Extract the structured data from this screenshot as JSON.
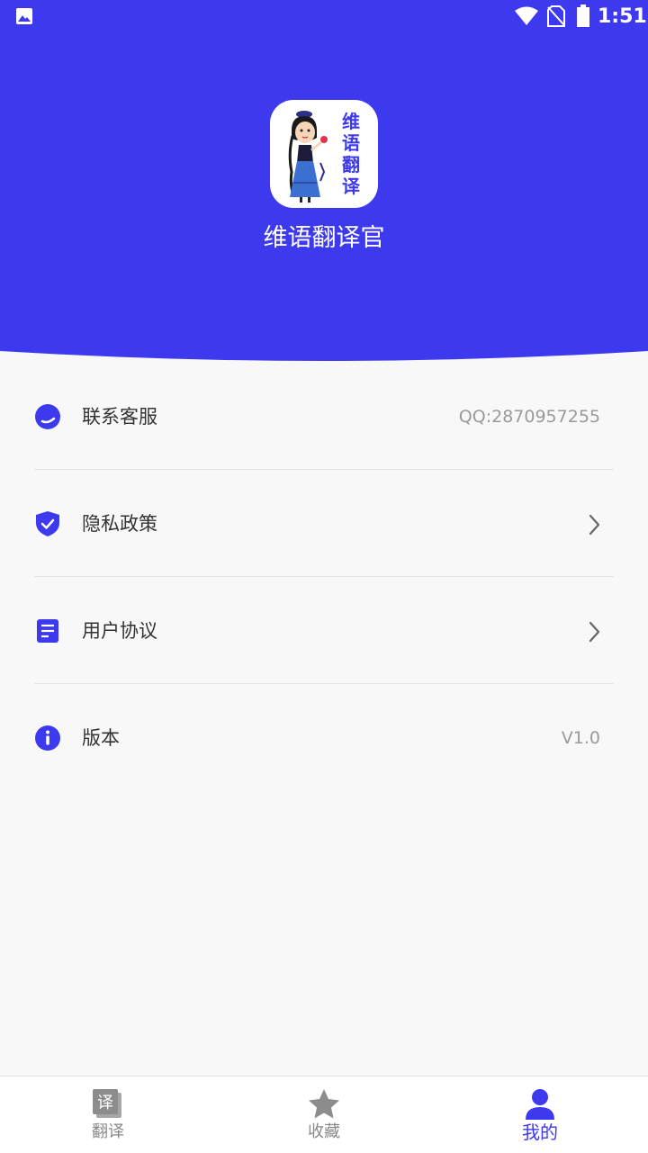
{
  "colors": {
    "brand": "#3d39ef",
    "background": "#f8f8f8",
    "text_primary": "#333333",
    "text_secondary": "#9a9a9a"
  },
  "status_bar": {
    "time": "1:51",
    "icons": [
      "photo-icon",
      "wifi-icon",
      "no-sim-icon",
      "battery-icon"
    ]
  },
  "header": {
    "logo_text": [
      "维",
      "语",
      "翻",
      "译"
    ],
    "app_name": "维语翻译官"
  },
  "menu": {
    "items": [
      {
        "icon": "customer-service-icon",
        "label": "联系客服",
        "value": "QQ:2870957255"
      },
      {
        "icon": "shield-check-icon",
        "label": "隐私政策",
        "chevron": true
      },
      {
        "icon": "document-icon",
        "label": "用户协议",
        "chevron": true
      },
      {
        "icon": "info-icon",
        "label": "版本",
        "value": "V1.0"
      }
    ]
  },
  "bottom_nav": {
    "items": [
      {
        "icon": "translate-icon",
        "label": "翻译",
        "active": false
      },
      {
        "icon": "star-icon",
        "label": "收藏",
        "active": false
      },
      {
        "icon": "person-icon",
        "label": "我的",
        "active": true
      }
    ]
  }
}
